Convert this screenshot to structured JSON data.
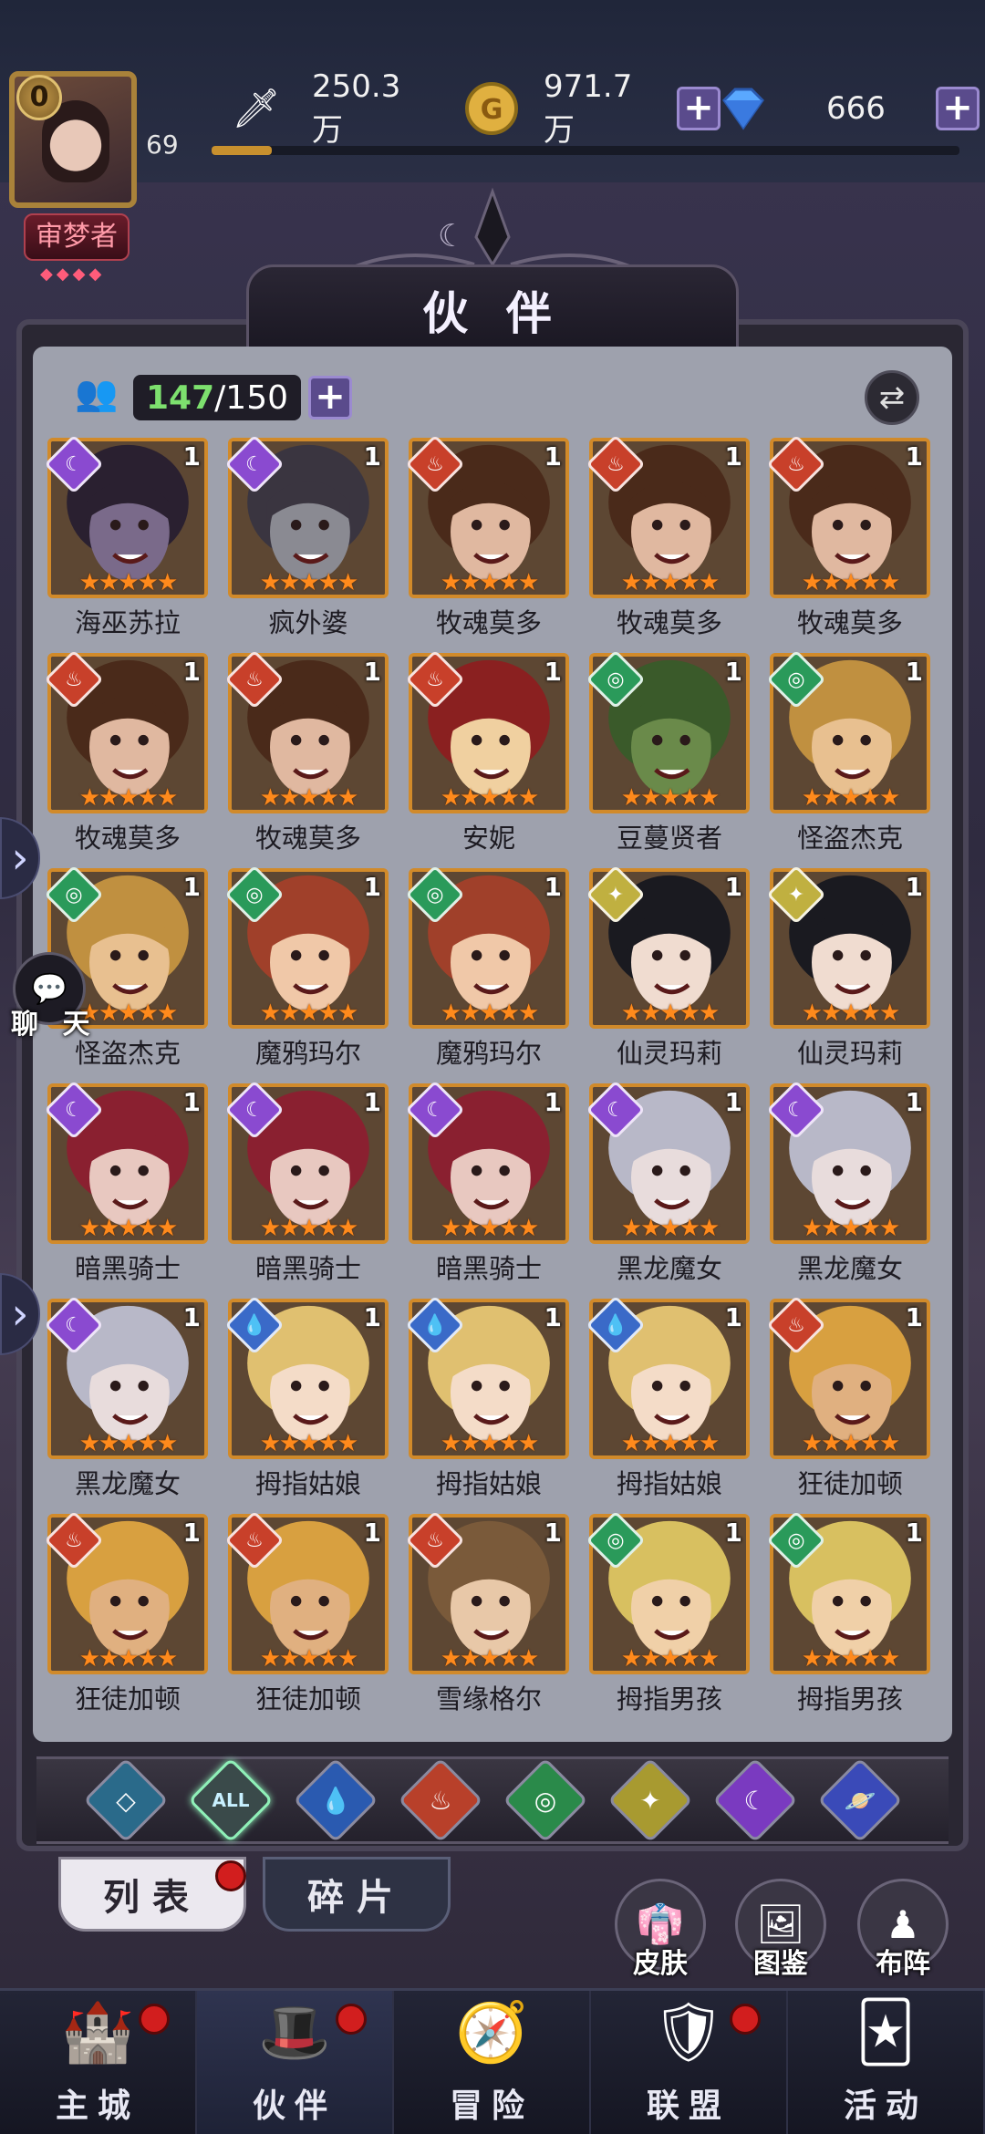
{
  "header": {
    "vip_level": "0",
    "player_level": "69",
    "title_badge": "审梦者",
    "power": "250.3万",
    "gold": "971.7万",
    "diamonds": "666",
    "power_bar_fraction": 0.08
  },
  "panel": {
    "title": "伙 伴",
    "count_current": "147",
    "count_max": "/150"
  },
  "heroes": [
    {
      "name": "海巫苏拉",
      "element": "moon",
      "level": "1",
      "hair": "#2a2030",
      "skin": "#7a6a8a"
    },
    {
      "name": "疯外婆",
      "element": "moon",
      "level": "1",
      "hair": "#3a3540",
      "skin": "#8a8a92"
    },
    {
      "name": "牧魂莫多",
      "element": "fire",
      "level": "1",
      "hair": "#4a2a1a",
      "skin": "#e0b8a0"
    },
    {
      "name": "牧魂莫多",
      "element": "fire",
      "level": "1",
      "hair": "#4a2a1a",
      "skin": "#e0b8a0"
    },
    {
      "name": "牧魂莫多",
      "element": "fire",
      "level": "1",
      "hair": "#4a2a1a",
      "skin": "#e0b8a0"
    },
    {
      "name": "牧魂莫多",
      "element": "fire",
      "level": "1",
      "hair": "#4a2a1a",
      "skin": "#e0b8a0"
    },
    {
      "name": "牧魂莫多",
      "element": "fire",
      "level": "1",
      "hair": "#4a2a1a",
      "skin": "#e0b8a0"
    },
    {
      "name": "安妮",
      "element": "fire",
      "level": "1",
      "hair": "#8a2020",
      "skin": "#f0d0a0"
    },
    {
      "name": "豆蔓贤者",
      "element": "wind",
      "level": "1",
      "hair": "#3a5a2a",
      "skin": "#6a8a4a"
    },
    {
      "name": "怪盗杰克",
      "element": "wind",
      "level": "1",
      "hair": "#c09040",
      "skin": "#e8c090"
    },
    {
      "name": "怪盗杰克",
      "element": "wind",
      "level": "1",
      "hair": "#c09040",
      "skin": "#e8c090"
    },
    {
      "name": "魔鸦玛尔",
      "element": "wind",
      "level": "1",
      "hair": "#a0402a",
      "skin": "#f0c8a8"
    },
    {
      "name": "魔鸦玛尔",
      "element": "wind",
      "level": "1",
      "hair": "#a0402a",
      "skin": "#f0c8a8"
    },
    {
      "name": "仙灵玛莉",
      "element": "light",
      "level": "1",
      "hair": "#1a1a20",
      "skin": "#f0dcd0"
    },
    {
      "name": "仙灵玛莉",
      "element": "light",
      "level": "1",
      "hair": "#1a1a20",
      "skin": "#f0dcd0"
    },
    {
      "name": "暗黑骑士",
      "element": "moon",
      "level": "1",
      "hair": "#8a2030",
      "skin": "#e8c8c0"
    },
    {
      "name": "暗黑骑士",
      "element": "moon",
      "level": "1",
      "hair": "#8a2030",
      "skin": "#e8c8c0"
    },
    {
      "name": "暗黑骑士",
      "element": "moon",
      "level": "1",
      "hair": "#8a2030",
      "skin": "#e8c8c0"
    },
    {
      "name": "黑龙魔女",
      "element": "moon",
      "level": "1",
      "hair": "#b8b8c8",
      "skin": "#e8dcdc"
    },
    {
      "name": "黑龙魔女",
      "element": "moon",
      "level": "1",
      "hair": "#b8b8c8",
      "skin": "#e8dcdc"
    },
    {
      "name": "黑龙魔女",
      "element": "moon",
      "level": "1",
      "hair": "#b8b8c8",
      "skin": "#e8dcdc"
    },
    {
      "name": "拇指姑娘",
      "element": "water",
      "level": "1",
      "hair": "#e0c070",
      "skin": "#f4dcc8"
    },
    {
      "name": "拇指姑娘",
      "element": "water",
      "level": "1",
      "hair": "#e0c070",
      "skin": "#f4dcc8"
    },
    {
      "name": "拇指姑娘",
      "element": "water",
      "level": "1",
      "hair": "#e0c070",
      "skin": "#f4dcc8"
    },
    {
      "name": "狂徒加顿",
      "element": "fire",
      "level": "1",
      "hair": "#d8a040",
      "skin": "#e0b080"
    },
    {
      "name": "狂徒加顿",
      "element": "fire",
      "level": "1",
      "hair": "#d8a040",
      "skin": "#e0b080"
    },
    {
      "name": "狂徒加顿",
      "element": "fire",
      "level": "1",
      "hair": "#d8a040",
      "skin": "#e0b080"
    },
    {
      "name": "雪缘格尔",
      "element": "fire",
      "level": "1",
      "hair": "#7a5a3a",
      "skin": "#e8c8a8"
    },
    {
      "name": "拇指男孩",
      "element": "wind",
      "level": "1",
      "hair": "#d8c060",
      "skin": "#f0d0a8"
    },
    {
      "name": "拇指男孩",
      "element": "wind",
      "level": "1",
      "hair": "#d8c060",
      "skin": "#f0d0a8"
    }
  ],
  "element_styles": {
    "moon": {
      "color": "#8a4ad0",
      "glyph": "☾"
    },
    "fire": {
      "color": "#c8402a",
      "glyph": "♨"
    },
    "wind": {
      "color": "#2a9a5a",
      "glyph": "◎"
    },
    "light": {
      "color": "#c0b040",
      "glyph": "✦"
    },
    "water": {
      "color": "#3a6ac8",
      "glyph": "💧"
    }
  },
  "filters": [
    {
      "name": "filter-default-icon",
      "glyph": "◇",
      "color": "#2a6a8a",
      "active": false
    },
    {
      "name": "filter-all-icon",
      "glyph": "ALL",
      "color": "#3a4a4a",
      "active": true
    },
    {
      "name": "filter-water-icon",
      "glyph": "💧",
      "color": "#2a5ab0",
      "active": false
    },
    {
      "name": "filter-fire-icon",
      "glyph": "♨",
      "color": "#b8402a",
      "active": false
    },
    {
      "name": "filter-wind-icon",
      "glyph": "◎",
      "color": "#2a8a4a",
      "active": false
    },
    {
      "name": "filter-light-icon",
      "glyph": "✦",
      "color": "#a89a30",
      "active": false
    },
    {
      "name": "filter-moon-icon",
      "glyph": "☾",
      "color": "#7a3ac0",
      "active": false
    },
    {
      "name": "filter-planet-icon",
      "glyph": "🪐",
      "color": "#3a4ab8",
      "active": false
    }
  ],
  "tabs": {
    "list": "列表",
    "fragments": "碎片"
  },
  "side_buttons": {
    "skin": "皮肤",
    "codex": "图鉴",
    "formation": "布阵"
  },
  "chat_label": "聊 天",
  "nav": [
    {
      "label": "主城",
      "icon": "castle-icon",
      "glyph": "🏰",
      "dot": true,
      "active": false
    },
    {
      "label": "伙伴",
      "icon": "witch-hat-icon",
      "glyph": "🎩",
      "dot": true,
      "active": true
    },
    {
      "label": "冒险",
      "icon": "compass-icon",
      "glyph": "🧭",
      "dot": false,
      "active": false
    },
    {
      "label": "联盟",
      "icon": "shield-icon",
      "glyph": "🛡",
      "dot": true,
      "active": false
    },
    {
      "label": "活动",
      "icon": "cards-icon",
      "glyph": "🃏",
      "dot": false,
      "active": false
    }
  ],
  "stars": "★★★★★"
}
